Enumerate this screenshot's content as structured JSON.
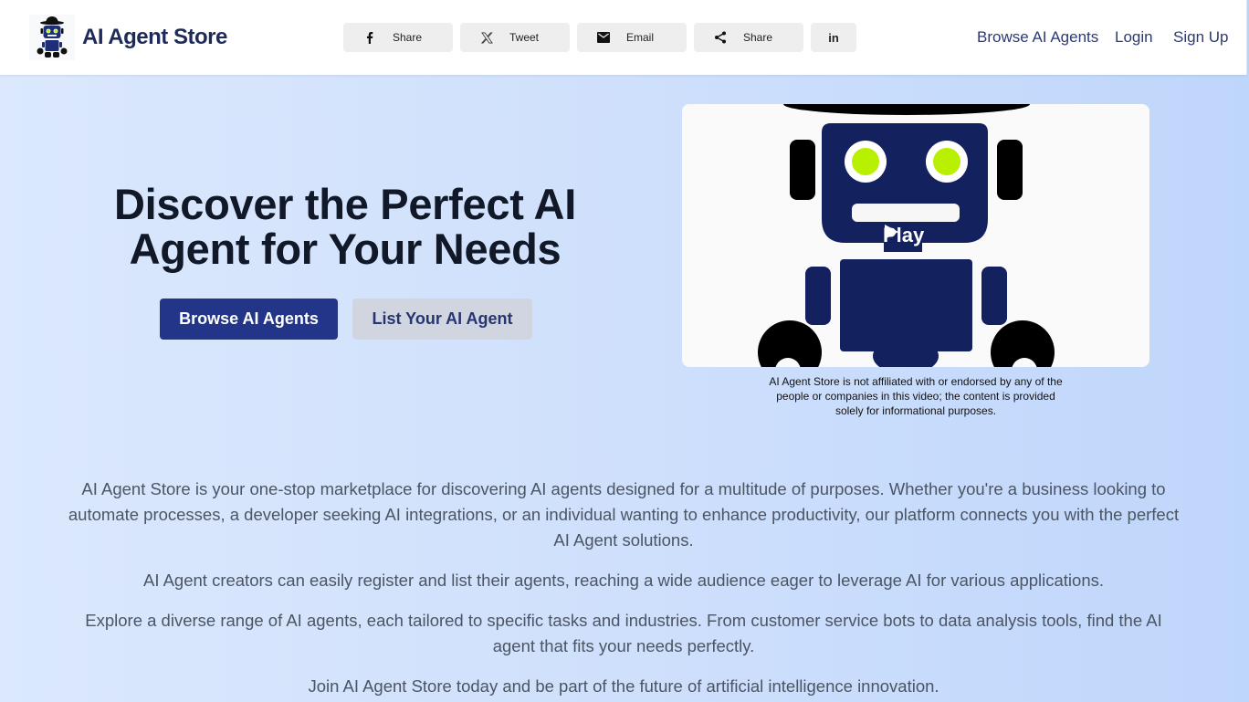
{
  "header": {
    "brand": "AI Agent Store",
    "share_buttons": [
      {
        "icon": "facebook-icon",
        "label": "Share"
      },
      {
        "icon": "x-twitter-icon",
        "label": "Tweet"
      },
      {
        "icon": "email-icon",
        "label": "Email"
      },
      {
        "icon": "share-icon",
        "label": "Share"
      },
      {
        "icon": "linkedin-icon",
        "label": "in"
      }
    ],
    "nav": [
      "Browse AI Agents",
      "Login",
      "Sign Up"
    ]
  },
  "hero": {
    "title": "Discover the Perfect AI Agent for Your Needs",
    "primary_button": "Browse AI Agents",
    "secondary_button": "List Your AI Agent",
    "video": {
      "play_label": "Play",
      "disclaimer": "AI Agent Store is not affiliated with or endorsed by any of the people or companies in this video; the content is provided solely for informational purposes."
    }
  },
  "paragraphs": [
    "AI Agent Store is your one-stop marketplace for discovering AI agents designed for a multitude of purposes. Whether you're a business looking to automate processes, a developer seeking AI integrations, or an individual wanting to enhance productivity, our platform connects you with the perfect AI Agent solutions.",
    "AI Agent creators can easily register and list their agents, reaching a wide audience eager to leverage AI for various applications.",
    "Explore a diverse range of AI agents, each tailored to specific tasks and industries. From customer service bots to data analysis tools, find the AI agent that fits your needs perfectly.",
    "Join AI Agent Store today and be part of the future of artificial intelligence innovation."
  ],
  "colors": {
    "brand_navy": "#1e2a5a",
    "primary_button": "#233588",
    "robot_navy": "#14215f",
    "robot_eye": "#b8f000"
  }
}
